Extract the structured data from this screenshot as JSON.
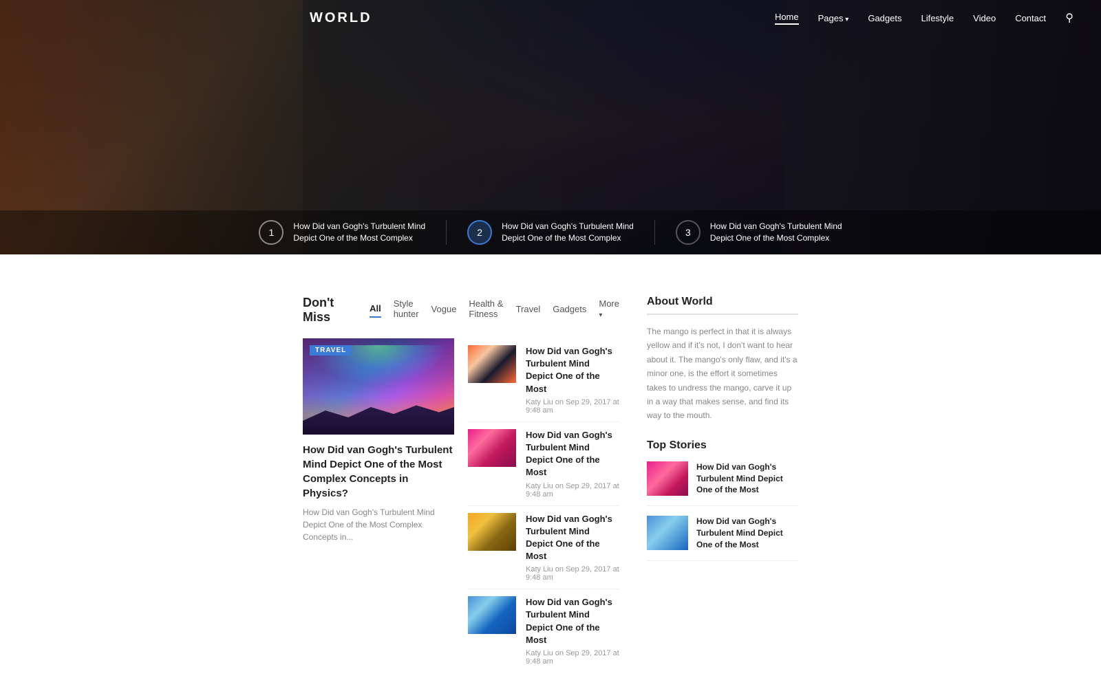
{
  "nav": {
    "logo": "WORLD",
    "links": [
      {
        "label": "Home",
        "active": true,
        "has_arrow": false
      },
      {
        "label": "Pages",
        "active": false,
        "has_arrow": true
      },
      {
        "label": "Gadgets",
        "active": false,
        "has_arrow": false
      },
      {
        "label": "Lifestyle",
        "active": false,
        "has_arrow": false
      },
      {
        "label": "Video",
        "active": false,
        "has_arrow": false
      },
      {
        "label": "Contact",
        "active": false,
        "has_arrow": false
      }
    ]
  },
  "hero": {
    "slides": [
      {
        "number": "1",
        "active": false,
        "title_line1": "How Did van Gogh's Turbulent Mind",
        "title_line2": "Depict One of the Most Complex"
      },
      {
        "number": "2",
        "active": true,
        "title_line1": "How Did van Gogh's Turbulent Mind",
        "title_line2": "Depict One of the Most Complex"
      },
      {
        "number": "3",
        "active": false,
        "title_line1": "How Did van Gogh's Turbulent Mind",
        "title_line2": "Depict One of the Most Complex"
      }
    ]
  },
  "dont_miss": {
    "section_title": "Don't Miss",
    "tabs": [
      {
        "label": "All",
        "active": true
      },
      {
        "label": "Style hunter",
        "active": false
      },
      {
        "label": "Vogue",
        "active": false
      },
      {
        "label": "Health & Fitness",
        "active": false
      },
      {
        "label": "Travel",
        "active": false
      },
      {
        "label": "Gadgets",
        "active": false
      },
      {
        "label": "More",
        "active": false,
        "has_arrow": true
      }
    ],
    "featured": {
      "badge": "TRAVEL",
      "title": "How Did van Gogh's Turbulent Mind Depict One of the Most Complex Concepts in Physics?",
      "excerpt": "How Did van Gogh's Turbulent Mind Depict One of the Most Complex Concepts in..."
    },
    "side_articles": [
      {
        "title": "How Did van Gogh's Turbulent Mind Depict One of the Most",
        "meta": "Katy Liu on Sep 29, 2017 at 9:48 am",
        "thumb_class": "thumb-gogh1"
      },
      {
        "title": "How Did van Gogh's Turbulent Mind Depict One of the Most",
        "meta": "Katy Liu on Sep 29, 2017 at 9:48 am",
        "thumb_class": "thumb-gogh2"
      },
      {
        "title": "How Did van Gogh's Turbulent Mind Depict One of the Most",
        "meta": "Katy Liu on Sep 29, 2017 at 9:48 am",
        "thumb_class": "thumb-gogh3"
      },
      {
        "title": "How Did van Gogh's Turbulent Mind Depict One of the Most",
        "meta": "Katy Liu on Sep 29, 2017 at 9:48 am",
        "thumb_class": "thumb-gogh4"
      }
    ]
  },
  "sidebar": {
    "about_title": "About World",
    "about_text": "The mango is perfect in that it is always yellow and if it's not, I don't want to hear about it. The mango's only flaw, and it's a minor one, is the effort it sometimes takes to undress the mango, carve it up in a way that makes sense, and find its way to the mouth.",
    "top_stories_title": "Top Stories",
    "top_stories": [
      {
        "title": "How Did van Gogh's Turbulent Mind Depict One of the Most",
        "thumb_class": "top-story-thumb-1"
      },
      {
        "title": "How Did van Gogh's Turbulent Mind Depict One of the Most",
        "thumb_class": "top-story-thumb-2"
      }
    ]
  }
}
